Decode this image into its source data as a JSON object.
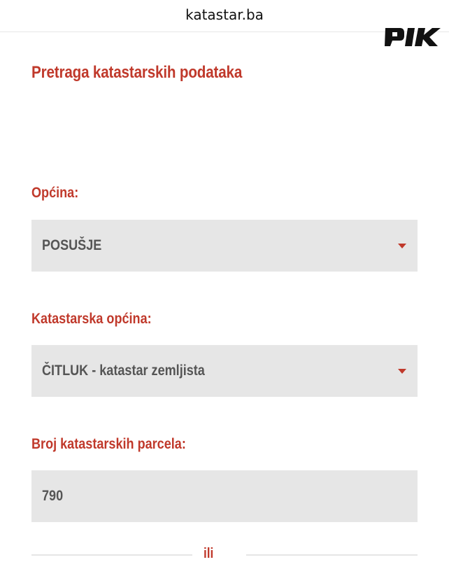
{
  "browser": {
    "url": "katastar.ba",
    "watermark": "PIK"
  },
  "page": {
    "title": "Pretraga katastarskih podataka"
  },
  "form": {
    "opcina": {
      "label": "Općina:",
      "value": "POSUŠJE"
    },
    "katastarska_opcina": {
      "label": "Katastarska općina:",
      "value": "ČITLUK - katastar zemljista"
    },
    "broj_parcela": {
      "label": "Broj katastarskih parcela:",
      "value": "790"
    },
    "divider": "ili"
  },
  "colors": {
    "accent": "#c0392b",
    "field_bg": "#e6e6e6",
    "field_text": "#555555"
  },
  "icons": {
    "dropdown": "caret-down-icon",
    "logo": "pik-logo"
  }
}
